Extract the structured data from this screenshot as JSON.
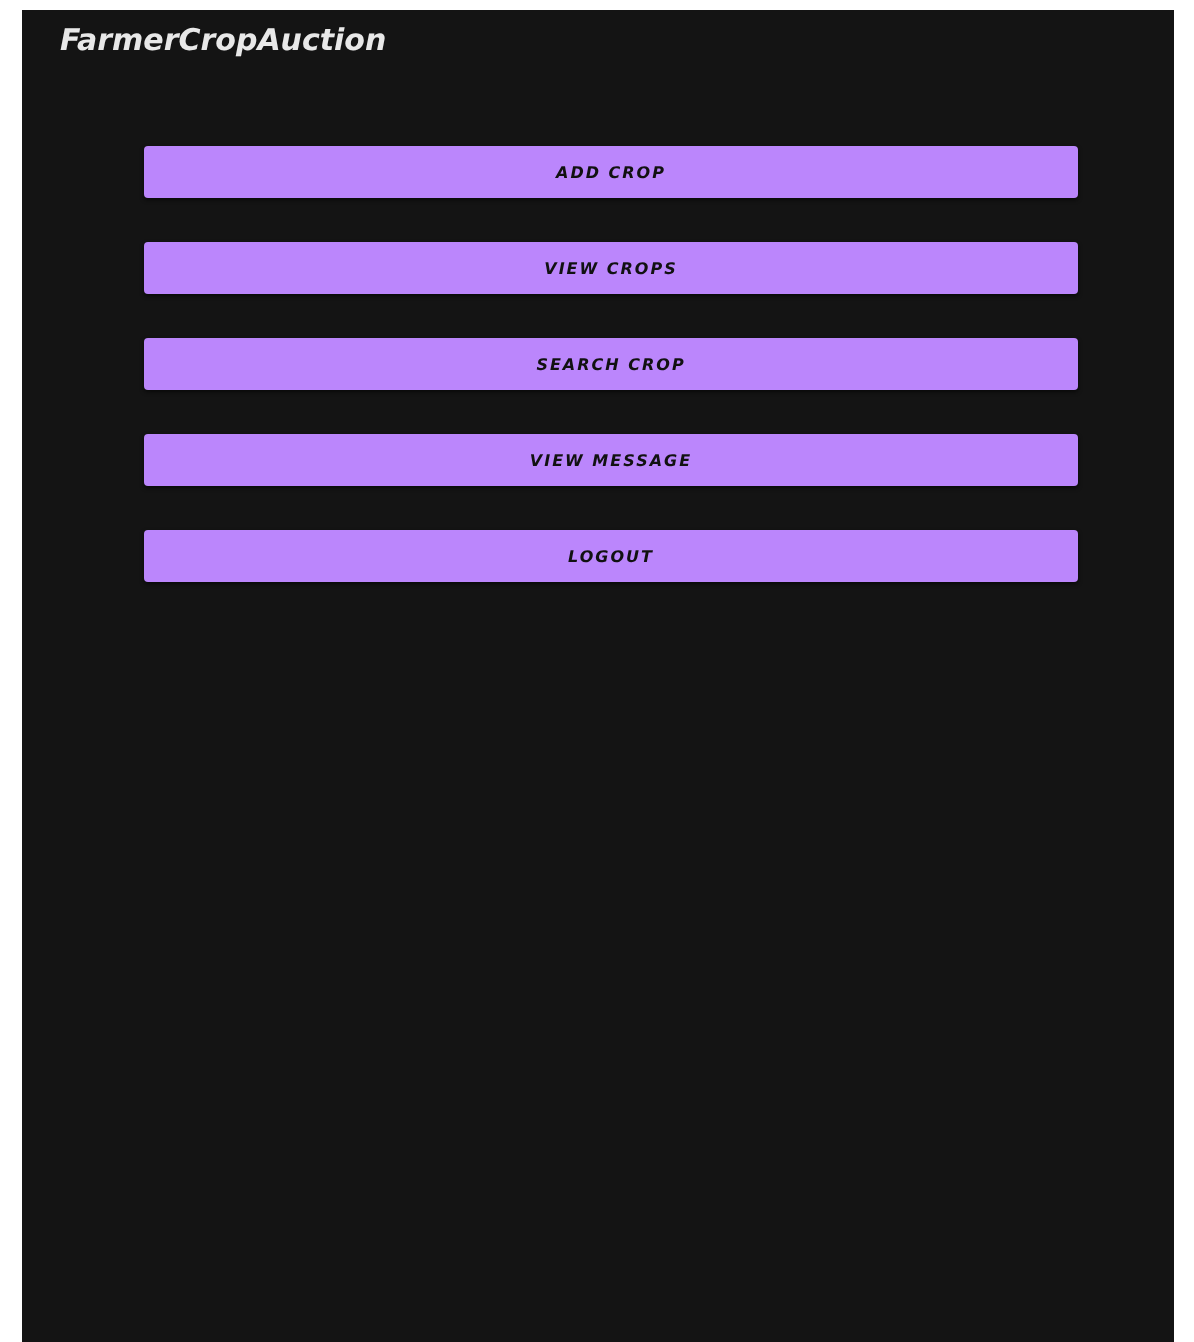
{
  "app_bar": {
    "title": "FarmerCropAuction"
  },
  "buttons": [
    {
      "label": "ADD CROP"
    },
    {
      "label": "VIEW CROPS"
    },
    {
      "label": "SEARCH CROP"
    },
    {
      "label": "VIEW MESSAGE"
    },
    {
      "label": "LOGOUT"
    }
  ]
}
